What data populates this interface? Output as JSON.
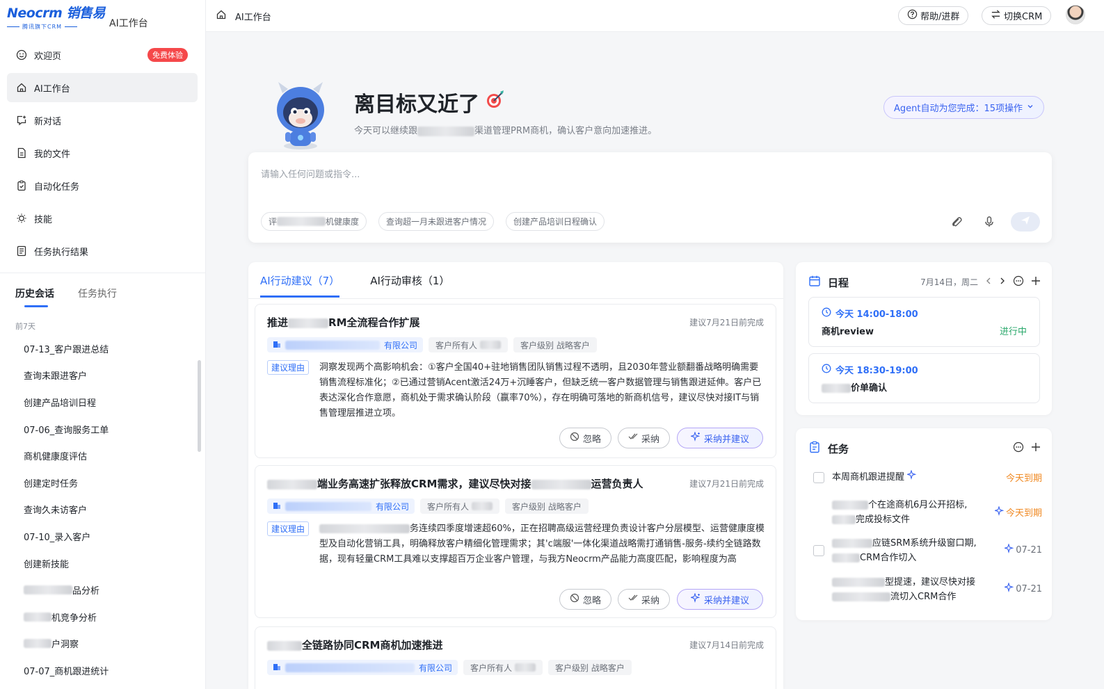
{
  "sidebar": {
    "logo_brand": "Neocrm 销售易",
    "logo_tagline": "腾讯旗下CRM",
    "workspace_label": "AI工作台",
    "nav": [
      {
        "label": "欢迎页",
        "icon": "smile-icon",
        "badge": "免费体验"
      },
      {
        "label": "AI工作台",
        "icon": "home-icon",
        "active": true
      },
      {
        "label": "新对话",
        "icon": "new-chat-icon"
      },
      {
        "label": "我的文件",
        "icon": "file-icon"
      },
      {
        "label": "自动化任务",
        "icon": "clipboard-check-icon"
      },
      {
        "label": "技能",
        "icon": "bulb-icon"
      },
      {
        "label": "任务执行结果",
        "icon": "list-doc-icon"
      }
    ],
    "history_tabs": [
      "历史会话",
      "任务执行"
    ],
    "history_group": "前7天",
    "history_items": [
      {
        "label": "07-13_客户跟进总结"
      },
      {
        "label": "查询未跟进客户"
      },
      {
        "label": "创建产品培训日程"
      },
      {
        "label": "07-06_查询服务工单"
      },
      {
        "label": "商机健康度评估"
      },
      {
        "label": "创建定时任务"
      },
      {
        "label": "查询久未访客户"
      },
      {
        "label": "07-10_录入客户"
      },
      {
        "label": "创建新技能"
      },
      {
        "label": "品分析",
        "redacted": true
      },
      {
        "label": "机竞争分析",
        "redacted": true
      },
      {
        "label": "户洞察",
        "redacted": true
      },
      {
        "label": "07-07_商机跟进统计"
      }
    ]
  },
  "topbar": {
    "breadcrumb": "AI工作台",
    "help_label": "帮助/进群",
    "switch_label": "切换CRM"
  },
  "hero": {
    "title": "离目标又近了",
    "subtitle_prefix": "今天可以继续跟",
    "subtitle_suffix": "渠道管理PRM商机，确认客户意向加速推进。",
    "agent_pill": "Agent自动为您完成：15项操作"
  },
  "ask": {
    "placeholder": "请输入任何问题或指令...",
    "chips": [
      "评",
      "机健康度",
      "查询超一月未跟进客户情况",
      "创建产品培训日程确认"
    ]
  },
  "suggestions": {
    "tabs": [
      "AI行动建议（7）",
      "AI行动审核（1）"
    ],
    "reason_label": "建议理由",
    "ignore_label": "忽略",
    "accept_label": "采纳",
    "adopt_label": "采纳并建议",
    "owner_label": "客户所有人",
    "level_label": "客户级别 战略客户",
    "cards": [
      {
        "title_a": "推进",
        "title_b": "RM全流程合作扩展",
        "due": "建议7月21日前完成",
        "company_suffix": "有限公司",
        "reason": "洞察发现两个高影响机会：①客户全国40+驻地销售团队销售过程不透明，且2030年营业额翻番战略明确需要销售流程标准化；②已通过营销Acent激活24万+沉睡客户，但缺乏统一客户数据管理与销售跟进延伸。客户已表达深化合作意愿，商机处于需求确认阶段（赢率70%），存在明确可落地的新商机信号，建议尽快对接IT与销售管理层推进立项。"
      },
      {
        "title_a": "端业务高速扩张释放CRM需求，建议尽快对接",
        "title_b": "运营负责人",
        "due": "建议7月21日前完成",
        "company_suffix": "有限公司",
        "reason_a": "务连续四季度增速超60%，正在招聘高级运营经理负责设计客户分层模型、运营健康度模型及自动化营销工具，明确释放客户精细化管理需求；其'c端服'一体化渠道战略需打通销售-服务-续约全链路数据，现有轻量CRM工具难以支撑超百万企业客户管理，与我方Neocrm产品能力高度匹配，影响程度为高"
      },
      {
        "title_b": "全链路协同CRM商机加速推进",
        "due": "建议7月14日前完成",
        "company_suffix": "有限公司"
      }
    ]
  },
  "schedule": {
    "title": "日程",
    "date": "7月14日，周二",
    "items": [
      {
        "time": "今天 14:00-18:00",
        "name": "商机review",
        "status": "进行中"
      },
      {
        "time": "今天 18:30-19:00",
        "name": "价单确认",
        "redacted_prefix": true
      }
    ]
  },
  "tasks": {
    "title": "任务",
    "items": [
      {
        "text": "本周商机跟进提醒",
        "due": "今天到期",
        "ai": true
      },
      {
        "text_a": "个在途商机6月公开招标,",
        "text_b": "完成投标文件",
        "due": "今天到期",
        "ai": true
      },
      {
        "text_a": "应链SRM系统升级窗口期,",
        "text_b": "CRM合作切入",
        "due": "07-21",
        "ai": true
      },
      {
        "text_a": "型提速，建议尽快对接",
        "text_b": "流切入CRM合作",
        "due": "07-21",
        "ai": true
      }
    ]
  },
  "colors": {
    "accent": "#2f6ff7",
    "badge_red": "#f5484a",
    "due_orange": "#f08a24",
    "status_green": "#2aa86b"
  }
}
